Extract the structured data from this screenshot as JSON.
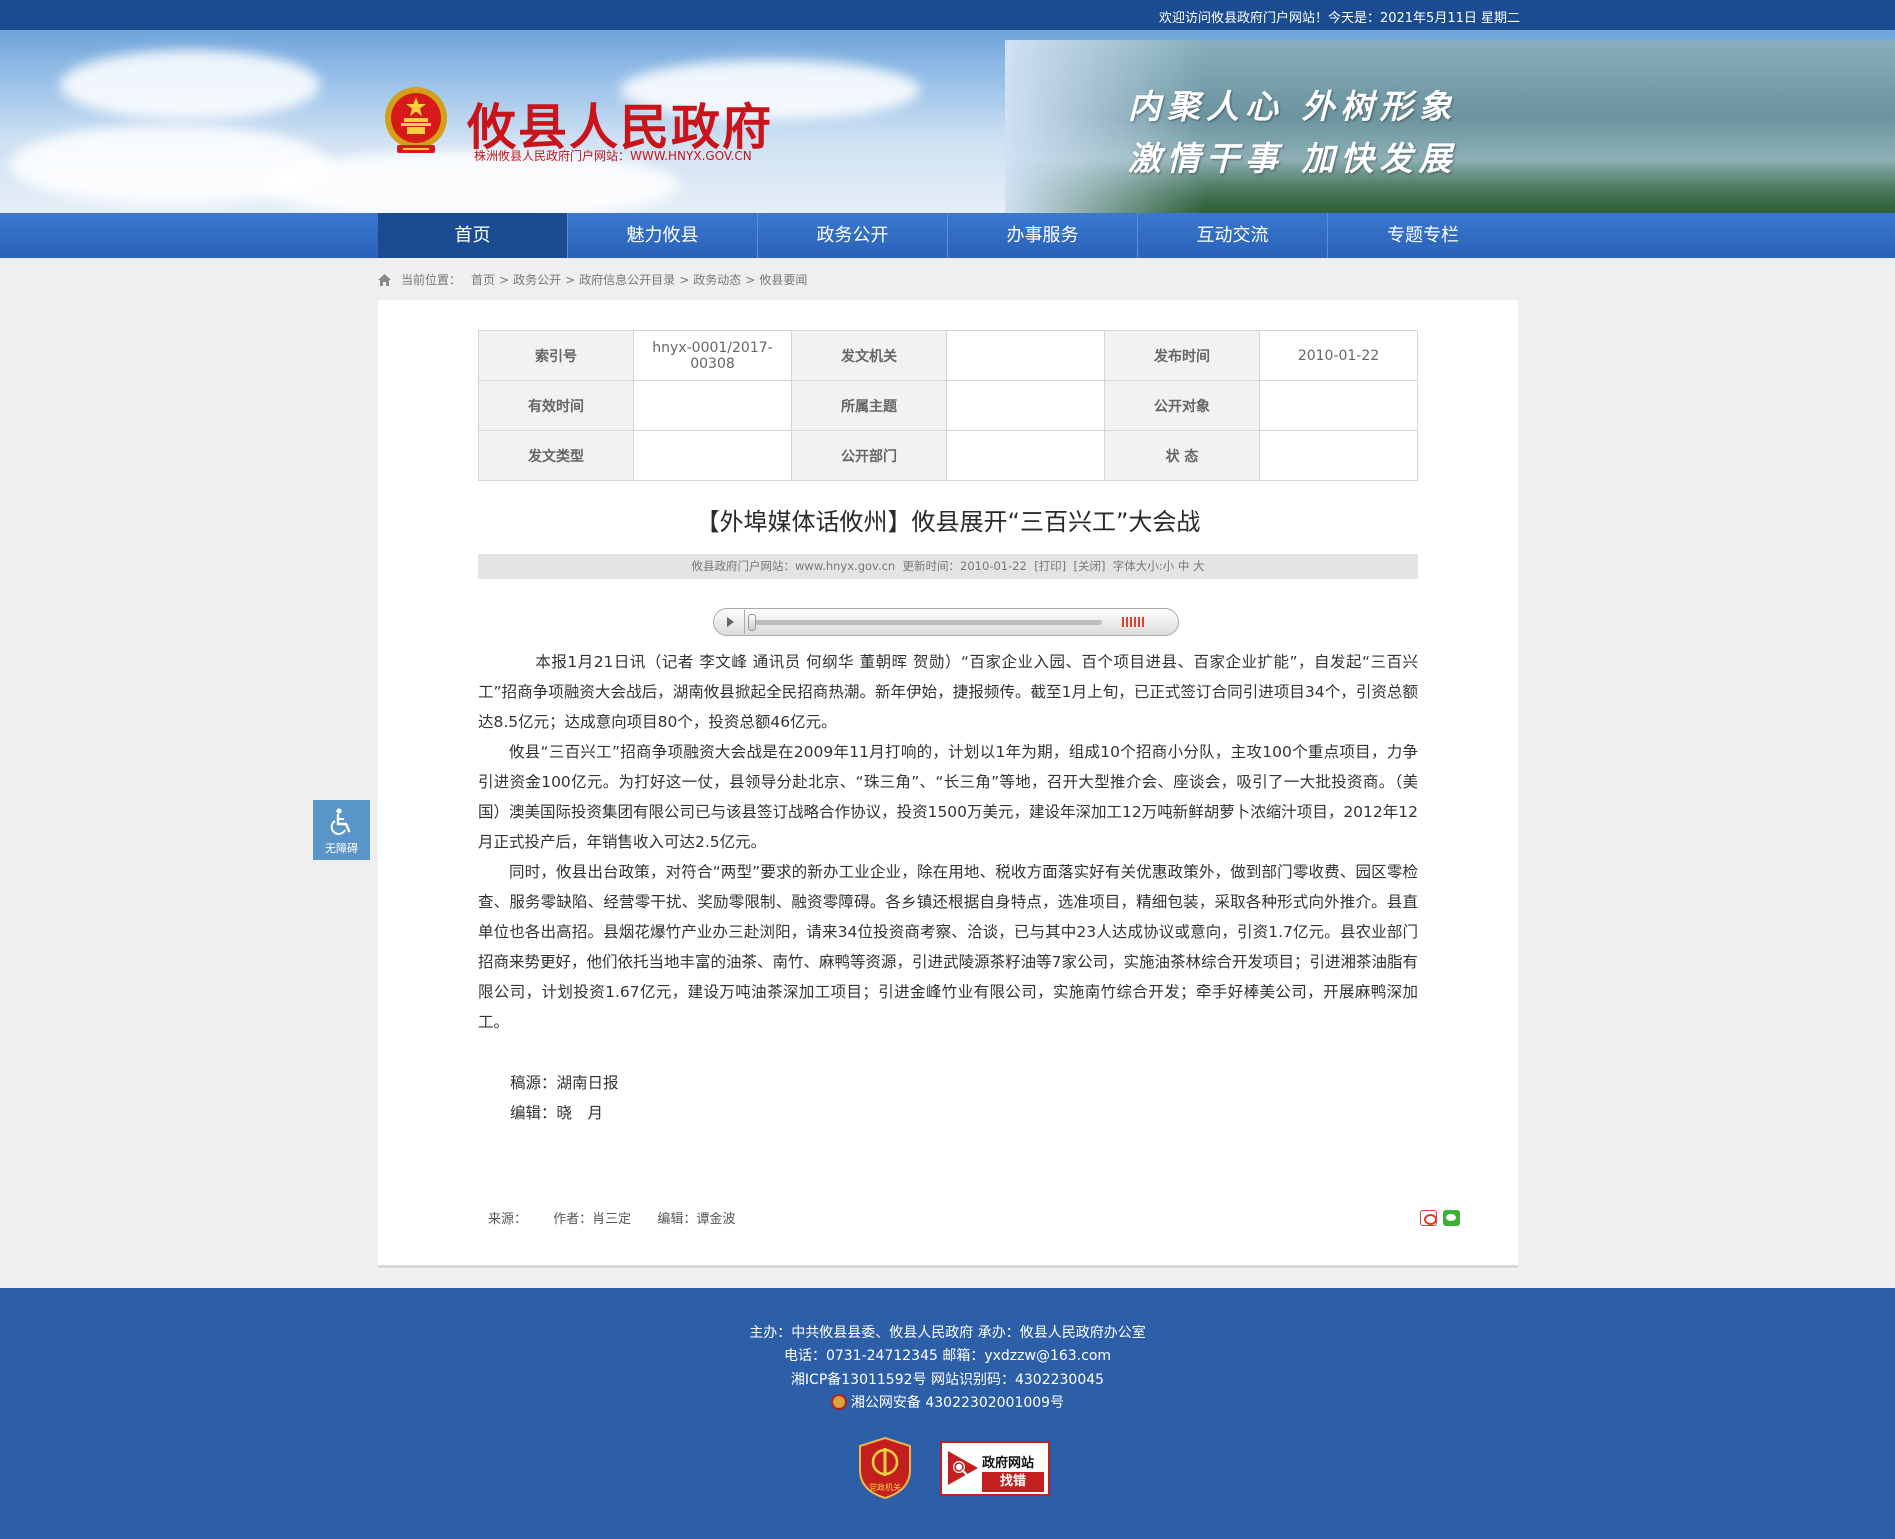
{
  "topbar": {
    "welcome": "欢迎访问攸县政府门户网站！今天是：2021年5月11日 星期二"
  },
  "header": {
    "site_title": "攸县人民政府",
    "site_subtitle": "株洲攸县人民政府门户网站：WWW.HNYX.GOV.CN",
    "slogan_line1": "内聚人心  外树形象",
    "slogan_line2": "激情干事  加快发展"
  },
  "nav": {
    "items": [
      {
        "label": "首页"
      },
      {
        "label": "魅力攸县"
      },
      {
        "label": "政务公开"
      },
      {
        "label": "办事服务"
      },
      {
        "label": "互动交流"
      },
      {
        "label": "专题专栏"
      }
    ]
  },
  "breadcrumb": {
    "prefix": "当前位置：",
    "items": [
      "首页",
      "政务公开",
      "政府信息公开目录",
      "政务动态",
      "攸县要闻"
    ],
    "separator": ">"
  },
  "meta": {
    "index_no_label": "索引号",
    "index_no_value": "hnyx-0001/2017-00308",
    "issuer_label": "发文机关",
    "issuer_value": "",
    "publish_label": "发布时间",
    "publish_value": "2010-01-22",
    "valid_label": "有效时间",
    "valid_value": "",
    "topic_label": "所属主题",
    "topic_value": "",
    "audience_label": "公开对象",
    "audience_value": "",
    "doctype_label": "发文类型",
    "doctype_value": "",
    "dept_label": "公开部门",
    "dept_value": "",
    "status_label": "状 态",
    "status_value": ""
  },
  "article": {
    "title": "【外埠媒体话攸州】攸县展开“三百兴工”大会战",
    "info_source": "攸县政府门户网站：www.hnyx.gov.cn",
    "info_updated": "更新时间：2010-01-22",
    "print_label": "[打印]",
    "close_label": "[关闭]",
    "font_size_label": "字体大小:",
    "font_small": "小",
    "font_medium": "中",
    "font_large": "大",
    "paragraphs": [
      "本报1月21日讯（记者 李文峰 通讯员 何纲华 董朝晖 贺勋）“百家企业入园、百个项目进县、百家企业扩能”，自发起“三百兴工”招商争项融资大会战后，湖南攸县掀起全民招商热潮。新年伊始，捷报频传。截至1月上旬，已正式签订合同引进项目34个，引资总额达8.5亿元；达成意向项目80个，投资总额46亿元。",
      "攸县“三百兴工”招商争项融资大会战是在2009年11月打响的，计划以1年为期，组成10个招商小分队，主攻100个重点项目，力争引进资金100亿元。为打好这一仗，县领导分赴北京、“珠三角”、“长三角”等地，召开大型推介会、座谈会，吸引了一大批投资商。（美国）澳美国际投资集团有限公司已与该县签订战略合作协议，投资1500万美元，建设年深加工12万吨新鲜胡萝卜浓缩汁项目，2012年12月正式投产后，年销售收入可达2.5亿元。",
      "同时，攸县出台政策，对符合“两型”要求的新办工业企业，除在用地、税收方面落实好有关优惠政策外，做到部门零收费、园区零检查、服务零缺陷、经营零干扰、奖励零限制、融资零障碍。各乡镇还根据自身特点，选准项目，精细包装，采取各种形式向外推介。县直单位也各出高招。县烟花爆竹产业办三赴浏阳，请来34位投资商考察、洽谈，已与其中23人达成协议或意向，引资1.7亿元。县农业部门招商来势更好，他们依托当地丰富的油茶、南竹、麻鸭等资源，引进武陵源茶籽油等7家公司，实施油茶林综合开发项目；引进湘茶油脂有限公司，计划投资1.67亿元，建设万吨油茶深加工项目；引进金峰竹业有限公司，实施南竹综合开发；牵手好棒美公司，开展麻鸭深加工。"
    ],
    "credit_source": "稿源：湖南日报",
    "credit_editor": "编辑：晓　月"
  },
  "sourcebar": {
    "source": "来源：",
    "author": "作者：肖三定",
    "editor": "编辑：谭金波"
  },
  "accessibility": {
    "label": "无障碍"
  },
  "footer": {
    "line1": "主办：中共攸县县委、攸县人民政府 承办：攸县人民政府办公室",
    "line2": "电话：0731-24712345 邮箱：yxdzzw@163.com",
    "line3": "湘ICP备13011592号   网站识别码：4302230045",
    "line4": "湘公网安备 43022302001009号",
    "party_badge": "党政机关",
    "err_title": "政府网站",
    "err_action": "找错"
  },
  "colors": {
    "topbar": "#1b4c92",
    "nav": "#2a62b8",
    "nav_active": "#1b4c92",
    "title_red": "#c8141b",
    "footer": "#2d5fa8"
  }
}
